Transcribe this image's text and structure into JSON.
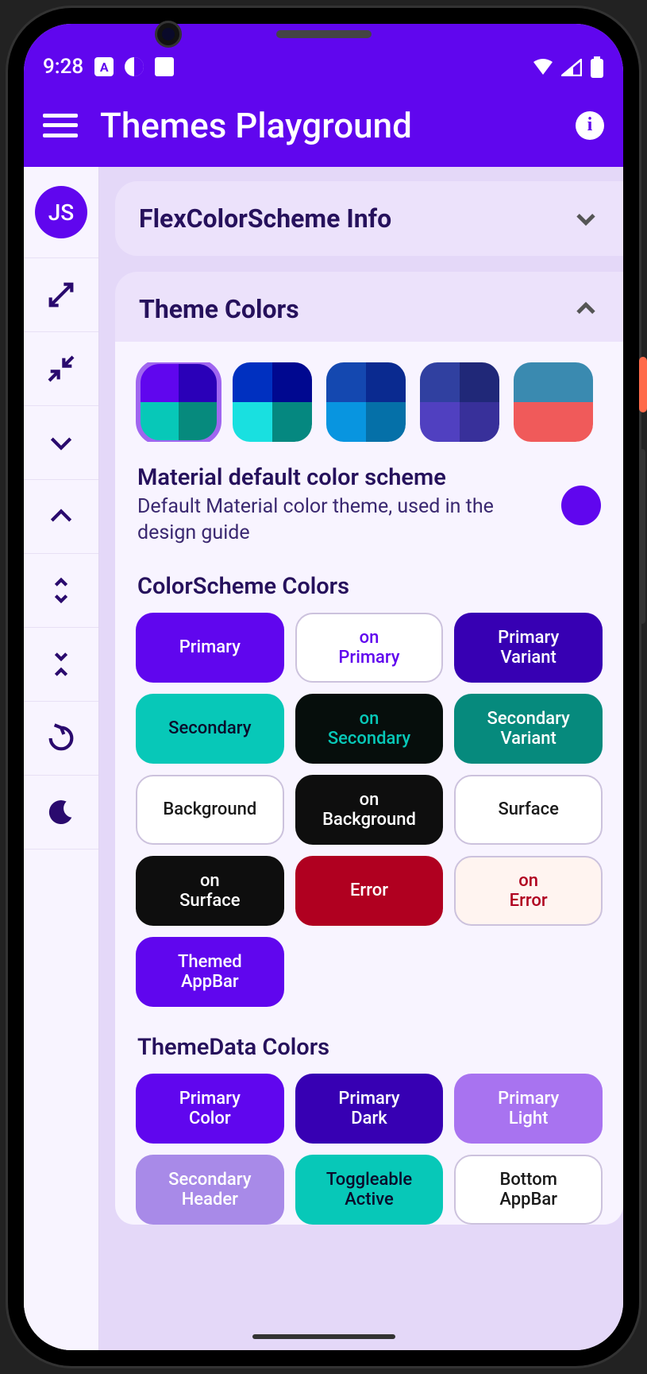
{
  "status": {
    "time": "9:28"
  },
  "appbar": {
    "title": "Themes Playground"
  },
  "sidebar": {
    "avatar": "JS"
  },
  "card_info": {
    "title": "FlexColorScheme Info"
  },
  "card_theme": {
    "title": "Theme Colors",
    "swatches": [
      {
        "c": [
          "#6006ee",
          "#2a00b8",
          "#07c8b8",
          "#068a7d"
        ],
        "selected": true
      },
      {
        "c": [
          "#0030c0",
          "#000890",
          "#19e0e0",
          "#058880"
        ]
      },
      {
        "c": [
          "#1448b0",
          "#0a2a90",
          "#0895e0",
          "#0570a8"
        ]
      },
      {
        "c": [
          "#3040a0",
          "#202878",
          "#5040c0",
          "#38309a"
        ]
      },
      {
        "c": [
          "#3a8ab0",
          "#3a8ab0",
          "#f05a5a",
          "#f05a5a"
        ]
      }
    ],
    "scheme_title": "Material default color scheme",
    "scheme_desc": "Default Material color theme, used in the design guide",
    "s1_title": "ColorScheme Colors",
    "s1_chips": [
      {
        "label": "Primary",
        "bg": "#6006ee",
        "fg": "#ffffff"
      },
      {
        "label": "on Primary",
        "bg": "#ffffff",
        "fg": "#6006ee",
        "border": true
      },
      {
        "label": "Primary Variant",
        "bg": "#3700b3",
        "fg": "#ffffff"
      },
      {
        "label": "Secondary",
        "bg": "#07c8b8",
        "fg": "#0a0a2a"
      },
      {
        "label": "on Secondary",
        "bg": "#060e0c",
        "fg": "#07c8b8"
      },
      {
        "label": "Secondary Variant",
        "bg": "#068a7d",
        "fg": "#ffffff"
      },
      {
        "label": "Background",
        "bg": "#ffffff",
        "fg": "#1a1a1a",
        "border": true
      },
      {
        "label": "on Background",
        "bg": "#0e0e0e",
        "fg": "#ffffff"
      },
      {
        "label": "Surface",
        "bg": "#ffffff",
        "fg": "#1a1a1a",
        "border": true
      },
      {
        "label": "on Surface",
        "bg": "#0e0e0e",
        "fg": "#ffffff"
      },
      {
        "label": "Error",
        "bg": "#b00020",
        "fg": "#ffffff"
      },
      {
        "label": "on Error",
        "bg": "#fff4f0",
        "fg": "#b00020",
        "border": true
      },
      {
        "label": "Themed AppBar",
        "bg": "#6006ee",
        "fg": "#ffffff"
      }
    ],
    "s2_title": "ThemeData Colors",
    "s2_chips": [
      {
        "label": "Primary Color",
        "bg": "#6006ee",
        "fg": "#ffffff"
      },
      {
        "label": "Primary Dark",
        "bg": "#3700b3",
        "fg": "#ffffff"
      },
      {
        "label": "Primary Light",
        "bg": "#a873f0",
        "fg": "#ffffff"
      },
      {
        "label": "Secondary Header",
        "bg": "#a88ae8",
        "fg": "#ffffff"
      },
      {
        "label": "Toggleable Active",
        "bg": "#07c8b8",
        "fg": "#0a0a2a"
      },
      {
        "label": "Bottom AppBar",
        "bg": "#ffffff",
        "fg": "#1a1a1a",
        "border": true
      }
    ]
  }
}
